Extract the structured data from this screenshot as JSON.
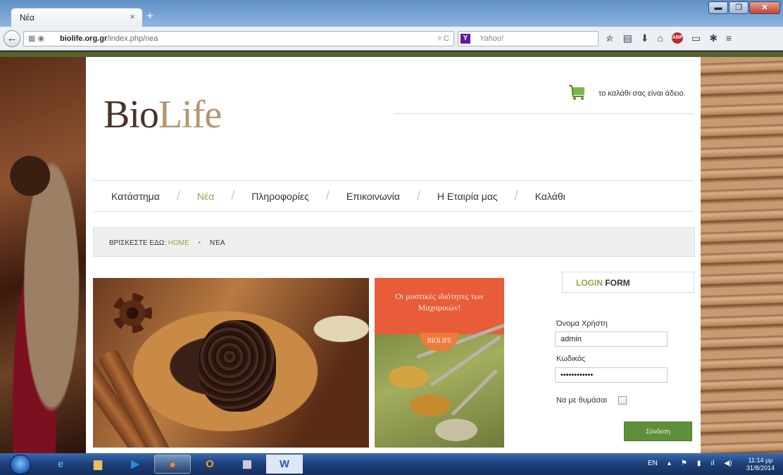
{
  "browser": {
    "tab_title": "Νέα",
    "tab_close": "×",
    "new_tab": "+",
    "url_host": "biolife.org.gr",
    "url_path": "/index.php/nea",
    "search_placeholder": "Yahoo!",
    "search_engine": "Y",
    "abp_label": "ABP",
    "window_buttons": {
      "minimize": "▬",
      "maximize": "❐",
      "close": "✕"
    }
  },
  "site": {
    "logo_bio": "Bio",
    "logo_life": "Life",
    "cart_text": "το καλάθι σας είναι άδειο.",
    "menu": [
      {
        "label": "Κατάστημα",
        "active": false
      },
      {
        "label": "Νέα",
        "active": true
      },
      {
        "label": "Πληροφορίες",
        "active": false
      },
      {
        "label": "Επικοινωνία",
        "active": false
      },
      {
        "label": "Η Εταιρία μας",
        "active": false
      },
      {
        "label": "Καλάθι",
        "active": false
      }
    ],
    "breadcrumb": {
      "prefix": "ΒΡΙΣΚΕΣΤΕ ΕΔΩ:",
      "home": "HOME",
      "separator": "•",
      "current": "ΝΈΑ"
    },
    "promo": {
      "text_line1": "Οι μυστικές ιδιότητες των",
      "text_line2": "Μαχαρικών!",
      "badge": "BIOLIFE"
    },
    "login": {
      "title_word1": "LOGIN",
      "title_word2": "FORM",
      "username_label": "Όνομα Χρήστη",
      "username_value": "admin",
      "password_label": "Κωδικός",
      "password_value": "••••••••••••",
      "remember_label": "Να με θυμάσαι",
      "remember_checked": false,
      "submit_label": "Σύνδεση"
    }
  },
  "taskbar": {
    "language": "EN",
    "time": "11:14 μμ",
    "date": "31/8/2014"
  },
  "colors": {
    "accent_green": "#8aac4a",
    "button_green": "#5f8f3a",
    "logo_dark": "#4a3427",
    "logo_light": "#b49670",
    "promo_orange": "#e85c3a"
  }
}
